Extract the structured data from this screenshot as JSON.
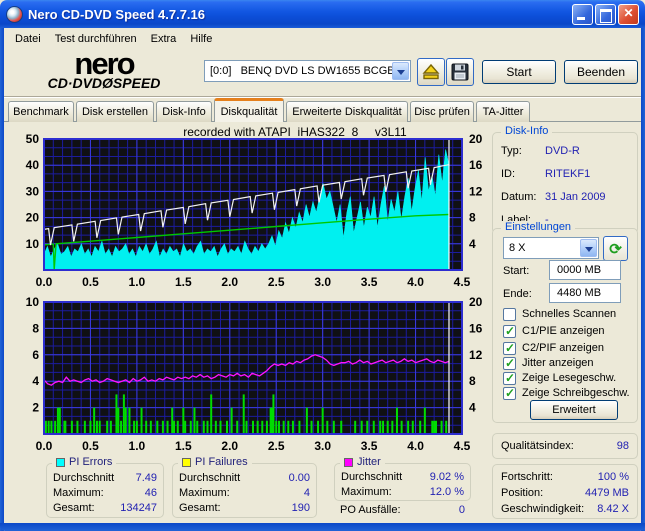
{
  "window": {
    "title": "Nero CD-DVD Speed 4.7.7.16"
  },
  "menu": {
    "items": [
      "Datei",
      "Test durchführen",
      "Extra",
      "Hilfe"
    ]
  },
  "logo": {
    "line1": "nero",
    "line2": "CD·DVDØSPEED"
  },
  "toolbar": {
    "drive_select": "[0:0]   BENQ DVD LS DW1655 BCGB",
    "start_label": "Start",
    "quit_label": "Beenden"
  },
  "tabs": [
    {
      "label": "Benchmark"
    },
    {
      "label": "Disk erstellen"
    },
    {
      "label": "Disk-Info"
    },
    {
      "label": "Diskqualität"
    },
    {
      "label": "Erweiterte Diskqualität"
    },
    {
      "label": "Disc prüfen"
    },
    {
      "label": "TA-Jitter"
    }
  ],
  "chart_header": "recorded with ATAPI  iHAS322  8     v3L11",
  "chart_data": [
    {
      "type": "area",
      "title": "PI Errors / speed (top chart)",
      "x": {
        "min": 0,
        "max": 4.5,
        "ticks": [
          "0.0",
          "0.5",
          "1.0",
          "1.5",
          "2.0",
          "2.5",
          "3.0",
          "3.5",
          "4.0",
          "4.5"
        ]
      },
      "left_axis": {
        "min": 0,
        "max": 50,
        "ticks": [
          50,
          40,
          30,
          20,
          10
        ]
      },
      "right_axis": {
        "min": 0,
        "max": 20,
        "ticks": [
          20,
          16,
          12,
          8,
          4
        ]
      },
      "series": [
        {
          "name": "pi-errors",
          "type": "area",
          "color": "#00F0F0",
          "x_end": 4.36,
          "values": [
            6,
            9,
            5,
            8,
            10,
            6,
            7,
            9,
            5,
            8,
            7,
            10,
            6,
            8,
            5,
            9,
            7,
            11,
            6,
            8,
            5,
            9,
            7,
            8,
            10,
            6,
            8,
            5,
            9,
            7,
            10,
            6,
            8,
            11,
            5,
            8,
            6,
            9,
            7,
            8,
            5,
            10,
            7,
            8,
            6,
            9,
            11,
            6,
            8,
            7,
            9,
            5,
            8,
            10,
            6,
            8,
            7,
            9,
            6,
            11,
            8,
            6,
            9,
            7,
            10,
            8,
            10,
            13,
            9,
            15,
            12,
            18,
            14,
            20,
            16,
            22,
            18,
            25,
            20,
            26,
            22,
            28,
            33,
            27,
            30,
            24,
            18,
            25,
            12,
            22,
            28,
            14,
            20,
            26,
            16,
            24,
            20,
            28,
            16,
            25,
            32,
            18,
            27,
            22,
            30,
            19,
            28,
            35,
            22,
            31,
            38,
            26,
            43,
            30,
            36,
            28,
            44,
            33,
            46,
            40
          ]
        },
        {
          "name": "write-speed",
          "type": "line",
          "color": "#00C800",
          "width": 1.4,
          "points": [
            [
              0,
              9.6
            ],
            [
              0.1,
              9.9
            ],
            [
              0.11,
              0.3
            ],
            [
              0.13,
              10.0
            ],
            [
              0.5,
              11.0
            ],
            [
              1.0,
              12.4
            ],
            [
              1.5,
              13.8
            ],
            [
              2.0,
              15.2
            ],
            [
              2.5,
              16.6
            ],
            [
              3.0,
              18.0
            ],
            [
              3.5,
              19.4
            ],
            [
              4.0,
              20.7
            ],
            [
              4.36,
              21.2
            ]
          ]
        },
        {
          "name": "read-speed",
          "type": "line",
          "color": "#F2F2F2",
          "width": 1.2,
          "points": [
            [
              0,
              15.5
            ],
            [
              0.05,
              15.8
            ],
            [
              0.07,
              9.5
            ],
            [
              0.11,
              16.2
            ],
            [
              0.3,
              17.2
            ],
            [
              0.32,
              10.9
            ],
            [
              0.36,
              17.5
            ],
            [
              0.55,
              18.6
            ],
            [
              0.57,
              12.3
            ],
            [
              0.61,
              18.9
            ],
            [
              0.78,
              19.9
            ],
            [
              0.8,
              13.6
            ],
            [
              0.84,
              20.2
            ],
            [
              1.02,
              21.2
            ],
            [
              1.04,
              14.9
            ],
            [
              1.08,
              21.5
            ],
            [
              1.26,
              22.6
            ],
            [
              1.28,
              16.3
            ],
            [
              1.32,
              22.9
            ],
            [
              1.5,
              23.9
            ],
            [
              1.52,
              17.6
            ],
            [
              1.56,
              24.2
            ],
            [
              1.74,
              25.3
            ],
            [
              1.76,
              19.0
            ],
            [
              1.8,
              25.6
            ],
            [
              1.98,
              26.6
            ],
            [
              2.0,
              20.3
            ],
            [
              2.04,
              26.9
            ],
            [
              2.22,
              28.0
            ],
            [
              2.24,
              21.7
            ],
            [
              2.28,
              28.3
            ],
            [
              2.46,
              29.3
            ],
            [
              2.48,
              23.0
            ],
            [
              2.52,
              29.6
            ],
            [
              2.7,
              30.7
            ],
            [
              2.72,
              24.4
            ],
            [
              2.76,
              31.0
            ],
            [
              2.94,
              32.1
            ],
            [
              2.96,
              25.8
            ],
            [
              3.0,
              32.4
            ],
            [
              3.18,
              33.4
            ],
            [
              3.2,
              27.1
            ],
            [
              3.24,
              33.7
            ],
            [
              3.42,
              34.8
            ],
            [
              3.44,
              28.5
            ],
            [
              3.48,
              35.1
            ],
            [
              3.66,
              36.1
            ],
            [
              3.68,
              29.8
            ],
            [
              3.72,
              36.4
            ],
            [
              3.9,
              37.5
            ],
            [
              3.92,
              31.2
            ],
            [
              3.96,
              37.8
            ],
            [
              4.14,
              38.8
            ],
            [
              4.16,
              32.5
            ],
            [
              4.2,
              39.1
            ],
            [
              4.3,
              39.8
            ],
            [
              4.36,
              40.2
            ]
          ]
        },
        {
          "name": "position-cursor",
          "type": "vline",
          "color": "#FFFFFF",
          "x": 4.36
        }
      ]
    },
    {
      "type": "bar",
      "title": "PI Failures / Jitter (bottom chart)",
      "x": {
        "min": 0,
        "max": 4.5,
        "ticks": [
          "0.0",
          "0.5",
          "1.0",
          "1.5",
          "2.0",
          "2.5",
          "3.0",
          "3.5",
          "4.0",
          "4.5"
        ]
      },
      "left_axis": {
        "min": 0,
        "max": 10,
        "ticks": [
          10,
          8,
          6,
          4,
          2
        ]
      },
      "right_axis": {
        "min": 0,
        "max": 20,
        "ticks": [
          20,
          16,
          12,
          8,
          4
        ]
      },
      "series": [
        {
          "name": "pi-failures",
          "type": "bars",
          "color": "#00DD00",
          "bars": [
            [
              0.02,
              1
            ],
            [
              0.05,
              1
            ],
            [
              0.08,
              1
            ],
            [
              0.12,
              1
            ],
            [
              0.15,
              2
            ],
            [
              0.17,
              2
            ],
            [
              0.22,
              1
            ],
            [
              0.23,
              1
            ],
            [
              0.3,
              1
            ],
            [
              0.36,
              1
            ],
            [
              0.44,
              1
            ],
            [
              0.5,
              1
            ],
            [
              0.54,
              2
            ],
            [
              0.57,
              1
            ],
            [
              0.6,
              1
            ],
            [
              0.68,
              1
            ],
            [
              0.72,
              1
            ],
            [
              0.78,
              3
            ],
            [
              0.8,
              2
            ],
            [
              0.83,
              1
            ],
            [
              0.86,
              3
            ],
            [
              0.88,
              2
            ],
            [
              0.92,
              2
            ],
            [
              0.97,
              1
            ],
            [
              1.0,
              1
            ],
            [
              1.05,
              2
            ],
            [
              1.1,
              1
            ],
            [
              1.15,
              1
            ],
            [
              1.22,
              1
            ],
            [
              1.28,
              1
            ],
            [
              1.33,
              1
            ],
            [
              1.38,
              2
            ],
            [
              1.4,
              1
            ],
            [
              1.44,
              1
            ],
            [
              1.5,
              2
            ],
            [
              1.52,
              1
            ],
            [
              1.58,
              1
            ],
            [
              1.62,
              2
            ],
            [
              1.65,
              1
            ],
            [
              1.72,
              1
            ],
            [
              1.76,
              1
            ],
            [
              1.8,
              3
            ],
            [
              1.85,
              1
            ],
            [
              1.9,
              1
            ],
            [
              1.97,
              1
            ],
            [
              2.02,
              2
            ],
            [
              2.08,
              1
            ],
            [
              2.15,
              3
            ],
            [
              2.18,
              1
            ],
            [
              2.25,
              1
            ],
            [
              2.3,
              1
            ],
            [
              2.35,
              1
            ],
            [
              2.4,
              1
            ],
            [
              2.44,
              2
            ],
            [
              2.46,
              2
            ],
            [
              2.47,
              3
            ],
            [
              2.5,
              1
            ],
            [
              2.53,
              1
            ],
            [
              2.58,
              1
            ],
            [
              2.63,
              1
            ],
            [
              2.68,
              1
            ],
            [
              2.75,
              1
            ],
            [
              2.83,
              2
            ],
            [
              2.88,
              1
            ],
            [
              2.95,
              1
            ],
            [
              3.0,
              2
            ],
            [
              3.05,
              1
            ],
            [
              3.12,
              1
            ],
            [
              3.2,
              1
            ],
            [
              3.35,
              1
            ],
            [
              3.42,
              1
            ],
            [
              3.48,
              1
            ],
            [
              3.55,
              1
            ],
            [
              3.62,
              1
            ],
            [
              3.65,
              1
            ],
            [
              3.7,
              1
            ],
            [
              3.75,
              1
            ],
            [
              3.8,
              2
            ],
            [
              3.85,
              1
            ],
            [
              3.92,
              1
            ],
            [
              3.97,
              1
            ],
            [
              4.05,
              1
            ],
            [
              4.1,
              2
            ],
            [
              4.18,
              1
            ],
            [
              4.2,
              1
            ],
            [
              4.22,
              1
            ],
            [
              4.28,
              1
            ],
            [
              4.33,
              1
            ]
          ]
        },
        {
          "name": "jitter",
          "type": "line",
          "color": "#FF14FF",
          "width": 1.3,
          "x_end": 4.36,
          "values": [
            4.1,
            3.8,
            3.7,
            3.9,
            4.0,
            3.9,
            4.3,
            4.0,
            4.1,
            4.0,
            3.9,
            4.1,
            4.2,
            4.0,
            4.1,
            3.9,
            4.0,
            4.2,
            4.1,
            4.0,
            3.9,
            4.0,
            4.1,
            3.9,
            4.2,
            4.0,
            4.1,
            4.3,
            4.0,
            4.1,
            4.0,
            4.2,
            4.1,
            4.3,
            4.2,
            4.1,
            4.3,
            4.2,
            4.3,
            4.2,
            4.4,
            4.3,
            4.5,
            4.3,
            4.4,
            4.2,
            4.3,
            4.5,
            4.4,
            4.3,
            4.5,
            4.4,
            4.6,
            4.4,
            4.5,
            4.3,
            4.6,
            4.5,
            4.4,
            4.6,
            4.8,
            5.1,
            5.3,
            5.2,
            5.3,
            5.2,
            5.4,
            5.3,
            5.5,
            5.4,
            5.6,
            5.7,
            5.9,
            6.0,
            5.9,
            5.8,
            5.6,
            5.3,
            5.2,
            5.3,
            5.4,
            5.4,
            5.5,
            5.3,
            5.4,
            5.6,
            5.4,
            5.5,
            5.3,
            5.4,
            5.5,
            5.6,
            5.4,
            5.5,
            5.6,
            5.4,
            5.5,
            5.7,
            5.5,
            5.6,
            5.4,
            5.5,
            5.6,
            5.7,
            5.5,
            5.4,
            5.6,
            5.5,
            5.4,
            5.5
          ]
        },
        {
          "name": "position-cursor",
          "type": "vline",
          "color": "#FFFFFF",
          "x": 4.36
        }
      ]
    }
  ],
  "disk_info": {
    "title": "Disk-Info",
    "rows": [
      [
        "Typ:",
        "DVD-R"
      ],
      [
        "ID:",
        "RITEKF1"
      ],
      [
        "Datum:",
        "31 Jan 2009"
      ],
      [
        "Label:",
        "-"
      ]
    ]
  },
  "settings": {
    "title": "Einstellungen",
    "speed_select": "8 X",
    "start_label": "Start:",
    "start_value": "0000 MB",
    "end_label": "Ende:",
    "end_value": "4480 MB",
    "checkboxes": [
      {
        "label": "Schnelles Scannen",
        "checked": false
      },
      {
        "label": "C1/PIE anzeigen",
        "checked": true
      },
      {
        "label": "C2/PIF anzeigen",
        "checked": true
      },
      {
        "label": "Jitter anzeigen",
        "checked": true
      },
      {
        "label": "Zeige Lesegeschw.",
        "checked": true
      },
      {
        "label": "Zeige Schreibgeschw.",
        "checked": true
      }
    ],
    "advanced_label": "Erweitert"
  },
  "quality": {
    "label": "Qualitätsindex:",
    "value": "98"
  },
  "progress": {
    "rows": [
      [
        "Fortschritt:",
        "100 %"
      ],
      [
        "Position:",
        "4479 MB"
      ],
      [
        "Geschwindigkeit:",
        "8.42 X"
      ]
    ]
  },
  "stats": [
    {
      "title": "PI Errors",
      "swatch": "#00FFFF",
      "rows": [
        [
          "Durchschnitt",
          "7.49"
        ],
        [
          "Maximum:",
          "46"
        ],
        [
          "Gesamt:",
          "134247"
        ]
      ]
    },
    {
      "title": "PI Failures",
      "swatch": "#FFFF00",
      "rows": [
        [
          "Durchschnitt",
          "0.00"
        ],
        [
          "Maximum:",
          "4"
        ],
        [
          "Gesamt:",
          "190"
        ]
      ]
    },
    {
      "title": "Jitter",
      "swatch": "#FF00FF",
      "rows": [
        [
          "Durchschnitt",
          "9.02 %"
        ],
        [
          "Maximum:",
          "12.0 %"
        ]
      ]
    }
  ],
  "po_failures": {
    "label": "PO Ausfälle:",
    "value": "0"
  }
}
